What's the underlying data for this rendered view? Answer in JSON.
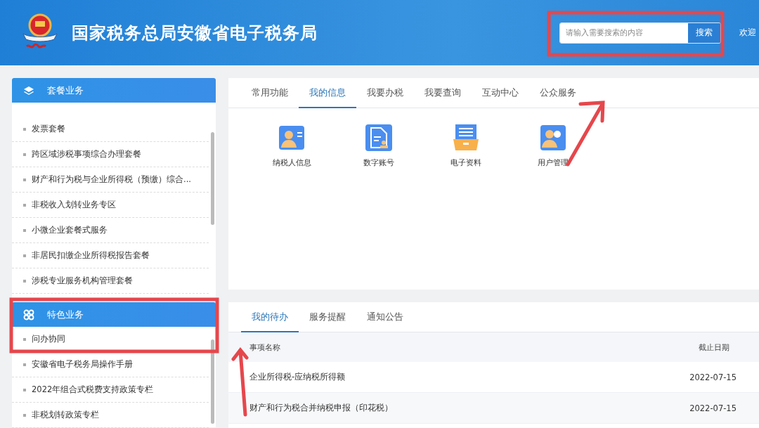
{
  "header": {
    "title": "国家税务总局安徽省电子税务局",
    "search": {
      "placeholder": "请输入需要搜索的内容",
      "button": "搜索"
    },
    "welcome": "欢迎"
  },
  "sidebar": [
    {
      "title": "套餐业务",
      "kind": "layers",
      "items": [
        "发票套餐",
        "跨区域涉税事项综合办理套餐",
        "财产和行为税与企业所得税（预缴）综合...",
        "非税收入划转业务专区",
        "小微企业套餐式服务",
        "非居民扣缴企业所得税报告套餐",
        "涉税专业服务机构管理套餐"
      ]
    },
    {
      "title": "特色业务",
      "kind": "grid",
      "items": [
        "问办协同",
        "安徽省电子税务局操作手册",
        "2022年组合式税费支持政策专栏",
        "非税划转政策专栏"
      ]
    }
  ],
  "function_panel": {
    "tabs": [
      {
        "label": "常用功能",
        "selected": false
      },
      {
        "label": "我的信息",
        "selected": true
      },
      {
        "label": "我要办税",
        "selected": false
      },
      {
        "label": "我要查询",
        "selected": false
      },
      {
        "label": "互动中心",
        "selected": false
      },
      {
        "label": "公众服务",
        "selected": false
      }
    ],
    "shortcuts": [
      {
        "label": "纳税人信息",
        "kind": "person-card"
      },
      {
        "label": "数字账号",
        "kind": "document-stamp"
      },
      {
        "label": "电子资料",
        "kind": "drawer"
      },
      {
        "label": "用户管理",
        "kind": "users"
      }
    ]
  },
  "todo_panel": {
    "tabs": [
      {
        "label": "我的待办",
        "selected": true
      },
      {
        "label": "服务提醒",
        "selected": false
      },
      {
        "label": "通知公告",
        "selected": false
      }
    ],
    "columns": [
      "事项名称",
      "截止日期"
    ],
    "rows": [
      [
        "企业所得税-应纳税所得额",
        "2022-07-15"
      ],
      [
        "财产和行为税合并纳税申报（印花税）",
        "2022-07-15"
      ]
    ]
  }
}
